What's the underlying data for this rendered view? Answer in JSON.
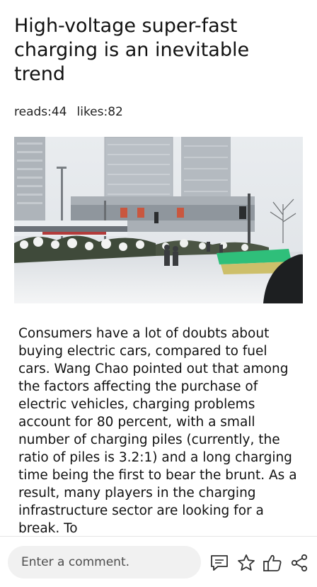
{
  "article": {
    "title": "High-voltage super-fast charging is an inevitable trend",
    "reads_label": "reads:44",
    "likes_label": "likes:82",
    "body": "Consumers have a lot of doubts about buying electric cars, compared to fuel cars. Wang Chao pointed out that among the factors affecting the purchase of electric vehicles, charging problems account for 80 percent, with a small number of charging piles (currently, the ratio of piles is 3.2:1) and a long charging time being the first to bear the brunt. As a result, many players in the charging infrastructure sector are looking for a break. To"
  },
  "bottom_bar": {
    "comment_placeholder": "Enter a comment.",
    "icons": [
      "comment-icon",
      "star-icon",
      "thumbs-up-icon",
      "share-icon"
    ]
  },
  "colors": {
    "icon_stroke": "#333333",
    "input_background": "#f1f1f1"
  }
}
